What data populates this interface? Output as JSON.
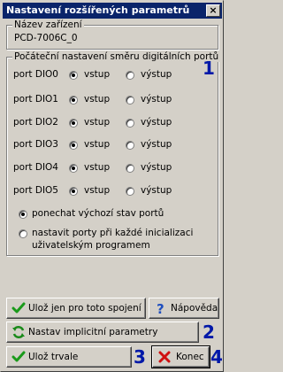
{
  "window": {
    "title": "Nastavení rozšířených parametrů",
    "close_label": "×"
  },
  "device": {
    "group_label": "Název zařízení",
    "name": "PCD-7006C_0"
  },
  "ports": {
    "group_label": "Počáteční nastavení směru digitálních portů",
    "option_in": "vstup",
    "option_out": "výstup",
    "rows": [
      {
        "label": "port DIO0",
        "selected": "vstup"
      },
      {
        "label": "port DIO1",
        "selected": "vstup"
      },
      {
        "label": "port DIO2",
        "selected": "vstup"
      },
      {
        "label": "port DIO3",
        "selected": "vstup"
      },
      {
        "label": "port DIO4",
        "selected": "vstup"
      },
      {
        "label": "port DIO5",
        "selected": "vstup"
      }
    ],
    "mode_keep": "ponechat výchozí stav portů",
    "mode_set_line1": "nastavit porty při každé inicializaci",
    "mode_set_line2": "uživatelským programem",
    "mode_selected": "keep"
  },
  "annotations": {
    "n1": "1",
    "n2": "2",
    "n3": "3",
    "n4": "4"
  },
  "buttons": {
    "save_connection": "Ulož jen pro toto spojení",
    "help": "Nápověda",
    "set_defaults": "Nastav implicitní parametry",
    "save_permanent": "Ulož trvale",
    "close": "Konec"
  },
  "colors": {
    "titlebar": "#0a246a",
    "annotation": "#0018a8",
    "check": "#1a9a1a",
    "cross": "#d01010"
  }
}
